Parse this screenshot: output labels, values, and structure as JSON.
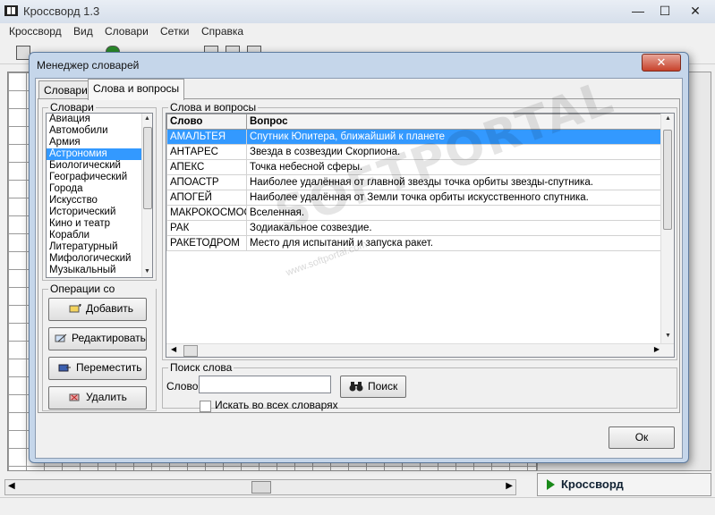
{
  "app": {
    "title": "Кроссворд 1.3",
    "window_controls": {
      "minimize": "—",
      "maximize": "☐",
      "close": "✕"
    },
    "menu": [
      "Кроссворд",
      "Вид",
      "Словари",
      "Сетки",
      "Справка"
    ],
    "bottom_button": "Кроссворд"
  },
  "dialog": {
    "title": "Менеджер словарей",
    "close": "✕",
    "tabs": [
      "Словари",
      "Слова и вопросы"
    ],
    "dictionaries": {
      "group_label": "Словари",
      "items": [
        "Авиация",
        "Автомобили",
        "Армия",
        "Астрономия",
        "Биологический",
        "Географический",
        "Города",
        "Искусство",
        "Исторический",
        "Кино и театр",
        "Корабли",
        "Литературный",
        "Мифологический",
        "Музыкальный"
      ],
      "selected_index": 3
    },
    "operations": {
      "group_label": "Операции со словами",
      "buttons": [
        "Добавить",
        "Редактировать",
        "Переместить",
        "Удалить"
      ]
    },
    "words": {
      "group_label": "Слова и вопросы",
      "headers": [
        "Слово",
        "Вопрос"
      ],
      "rows": [
        [
          "АМАЛЬТЕЯ",
          "Спутник Юпитера, ближайший к планете"
        ],
        [
          "АНТАРЕС",
          "Звезда в созвездии Скорпиона."
        ],
        [
          "АПЕКС",
          "Точка небесной сферы."
        ],
        [
          "АПОАСТР",
          "Наиболее удалённая от главной звезды точка орбиты звезды-спутника."
        ],
        [
          "АПОГЕЙ",
          "Наиболее удалённая от Земли точка орбиты искусственного спутника."
        ],
        [
          "МАКРОКОСМОС",
          "Вселенная."
        ],
        [
          "РАК",
          "Зодиакальное созвездие."
        ],
        [
          "РАКЕТОДРОМ",
          "Место для испытаний и запуска ракет."
        ]
      ],
      "selected_index": 0
    },
    "search": {
      "group_label": "Поиск слова",
      "field_label": "Слово",
      "value": "",
      "button": "Поиск",
      "checkbox_label": "Искать во всех словарях",
      "checked": false
    },
    "ok": "Ок"
  },
  "watermark": {
    "text": "SOFTPORTAL",
    "sub": "www.softportal.com"
  }
}
